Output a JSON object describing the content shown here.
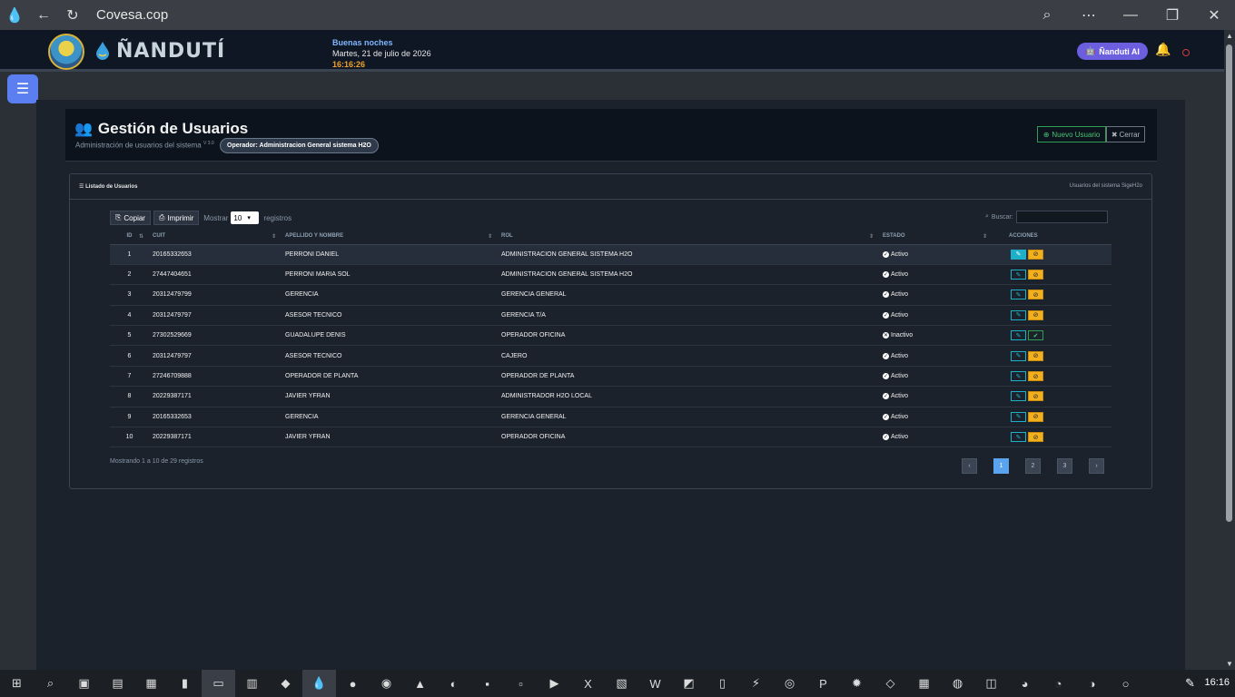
{
  "browser": {
    "title": "Covesa.cop",
    "icons": [
      "app-icon",
      "back-icon",
      "reload-icon",
      "zoom-icon",
      "more-icon",
      "minimize-icon",
      "restore-icon",
      "close-icon"
    ]
  },
  "header": {
    "brand": "ÑANDUTÍ",
    "greeting": "Buenas noches",
    "date": "Martes, 21 de julio de 2026",
    "time": "16:16:26",
    "ai_button": "Ñanduti AI"
  },
  "page": {
    "title": "Gestión de Usuarios",
    "subtitle": "Administración de usuarios del sistema",
    "version": "V 3.0",
    "operator": "Operador: Administracion General sistema H2O",
    "new_button": "Nuevo Usuario",
    "close_button": "Cerrar"
  },
  "card": {
    "title": "Listado de Usuarios",
    "note": "Usuarios del sistema SigeH2o"
  },
  "toolbar": {
    "copy": "Copiar",
    "print": "Imprimir",
    "show_label": "Mostrar",
    "page_size": "10",
    "records_label": "registros",
    "search_label": "Buscar:"
  },
  "table": {
    "columns": [
      "ID",
      "CUIT",
      "APELLIDO Y NOMBRE",
      "ROL",
      "ESTADO",
      "ACCIONES"
    ],
    "rows": [
      {
        "id": "1",
        "cuit": "20165332653",
        "name": "PERRONI DANIEL",
        "rol": "ADMINISTRACION GENERAL SISTEMA H2O",
        "estado": "Activo"
      },
      {
        "id": "2",
        "cuit": "27447404651",
        "name": "PERRONI MARIA SOL",
        "rol": "ADMINISTRACION GENERAL SISTEMA H2O",
        "estado": "Activo"
      },
      {
        "id": "3",
        "cuit": "20312479799",
        "name": "GERENCIA",
        "rol": "GERENCIA GENERAL",
        "estado": "Activo"
      },
      {
        "id": "4",
        "cuit": "20312479797",
        "name": "ASESOR TECNICO",
        "rol": "GERENCIA T/A",
        "estado": "Activo"
      },
      {
        "id": "5",
        "cuit": "27302529669",
        "name": "GUADALUPE DENIS",
        "rol": "OPERADOR OFICINA",
        "estado": "Inactivo"
      },
      {
        "id": "6",
        "cuit": "20312479797",
        "name": "ASESOR TECNICO",
        "rol": "CAJERO",
        "estado": "Activo"
      },
      {
        "id": "7",
        "cuit": "27246709888",
        "name": "OPERADOR DE PLANTA",
        "rol": "OPERADOR DE PLANTA",
        "estado": "Activo"
      },
      {
        "id": "8",
        "cuit": "20229387171",
        "name": "JAVIER YFRAN",
        "rol": "ADMINISTRADOR H2O LOCAL",
        "estado": "Activo"
      },
      {
        "id": "9",
        "cuit": "20165332653",
        "name": "GERENCIA",
        "rol": "GERENCIA GENERAL",
        "estado": "Activo"
      },
      {
        "id": "10",
        "cuit": "20229387171",
        "name": "JAVIER YFRAN",
        "rol": "OPERADOR OFICINA",
        "estado": "Activo"
      }
    ]
  },
  "footer": {
    "info": "Mostrando 1 a 10 de 29 registros",
    "pages": [
      "‹",
      "1",
      "2",
      "3",
      "›"
    ]
  },
  "taskbar": {
    "time": "16:16"
  },
  "colors": {
    "accent": "#5aa3ee",
    "ai_button": "#6b5fe0",
    "success": "#46c471",
    "warning": "#f2b01e",
    "info": "#1eb0c8"
  }
}
